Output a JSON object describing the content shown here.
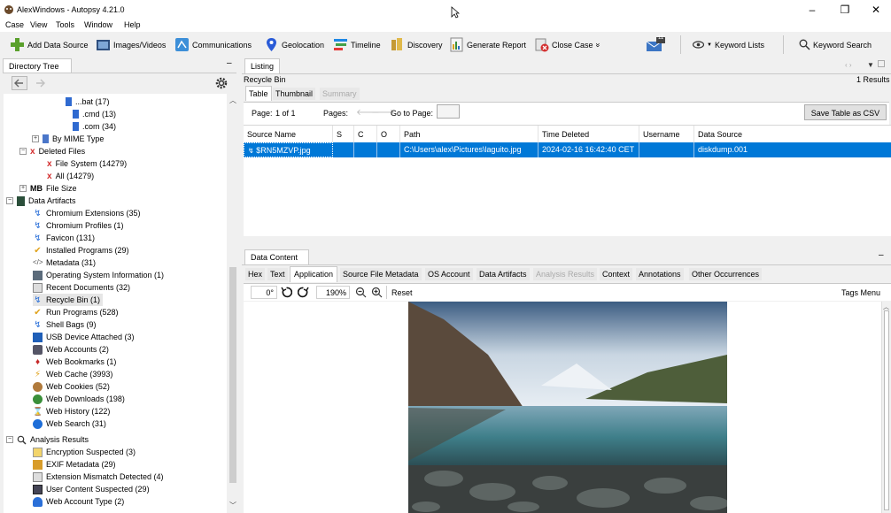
{
  "window": {
    "title": "AlexWindows - Autopsy 4.21.0",
    "controls": [
      "–",
      "❐",
      "✕"
    ]
  },
  "menu": [
    "Case",
    "View",
    "Tools",
    "Window",
    "Help"
  ],
  "toolbar": {
    "add_data_source": "Add Data Source",
    "images_videos": "Images/Videos",
    "communications": "Communications",
    "geolocation": "Geolocation",
    "timeline": "Timeline",
    "discovery": "Discovery",
    "generate_report": "Generate Report",
    "close_case": "Close Case",
    "close_case_more": "»",
    "mail_badge": "11",
    "keyword_lists": "Keyword Lists",
    "keyword_search": "Keyword Search"
  },
  "left_panel": {
    "tab": "Directory Tree",
    "minimize": "–",
    "tree": [
      "...bat (17)",
      ".cmd (13)",
      ".com (34)",
      "By MIME Type",
      "Deleted Files",
      "File System (14279)",
      "All (14279)",
      "File Size",
      "Data Artifacts",
      "Chromium Extensions (35)",
      "Chromium Profiles (1)",
      "Favicon (131)",
      "Installed Programs (29)",
      "Metadata (31)",
      "Operating System Information (1)",
      "Recent Documents (32)",
      "Recycle Bin (1)",
      "Run Programs (528)",
      "Shell Bags (9)",
      "USB Device Attached (3)",
      "Web Accounts (2)",
      "Web Bookmarks (1)",
      "Web Cache (3993)",
      "Web Cookies (52)",
      "Web Downloads (198)",
      "Web History (122)",
      "Web Search (31)",
      "Analysis Results",
      "Encryption Suspected (3)",
      "EXIF Metadata (29)",
      "Extension Mismatch Detected (4)",
      "User Content Suspected (29)",
      "Web Account Type (2)"
    ],
    "mb_label": "MB"
  },
  "listing": {
    "tab": "Listing",
    "breadcrumb": "Recycle Bin",
    "results": "1 Results",
    "subtabs": [
      "Table",
      "Thumbnail",
      "Summary"
    ],
    "page_label": "Page:",
    "page_value": "1 of 1",
    "pages_label": "Pages:",
    "go_to_page": "Go to Page:",
    "save_csv": "Save Table as CSV",
    "columns": [
      "Source Name",
      "S",
      "C",
      "O",
      "Path",
      "Time Deleted",
      "Username",
      "Data Source"
    ],
    "row": {
      "source_name": "$RN5MZVP.jpg",
      "s": "",
      "c": "",
      "o": "",
      "path": "C:\\Users\\alex\\Pictures\\laguito.jpg",
      "time_deleted": "2024-02-16 16:42:40 CET",
      "username": "",
      "data_source": "diskdump.001"
    }
  },
  "content": {
    "tab": "Data Content",
    "minimize": "–",
    "subtabs": [
      "Hex",
      "Text",
      "Application",
      "Source File Metadata",
      "OS Account",
      "Data Artifacts",
      "Analysis Results",
      "Context",
      "Annotations",
      "Other Occurrences"
    ],
    "rotation": "0°",
    "zoom": "190%",
    "reset": "Reset",
    "tags_menu": "Tags Menu"
  }
}
